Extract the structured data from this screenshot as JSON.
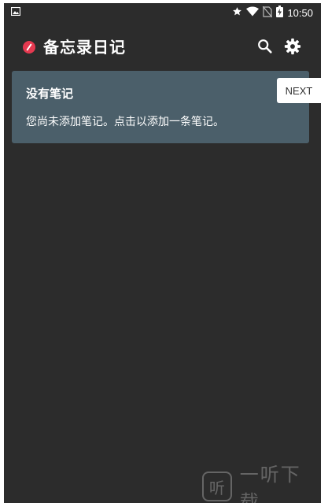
{
  "status_bar": {
    "time": "10:50",
    "icons": [
      "image-icon",
      "star-icon",
      "wifi-icon",
      "no-sim-icon",
      "battery-charging-icon"
    ]
  },
  "app_bar": {
    "title": "备忘录日记",
    "logo_icon": "pen-logo-icon",
    "actions": [
      "search-icon",
      "gear-icon"
    ]
  },
  "empty_state": {
    "title": "没有笔记",
    "message": "您尚未添加笔记。点击以添加一条笔记。"
  },
  "tour": {
    "next_label": "NEXT"
  },
  "watermark": {
    "logo_text": "听",
    "text": "一听下载"
  },
  "colors": {
    "background": "#2c2c2c",
    "card": "#4b5f6a",
    "accent": "#e53950",
    "text": "#ffffff"
  }
}
